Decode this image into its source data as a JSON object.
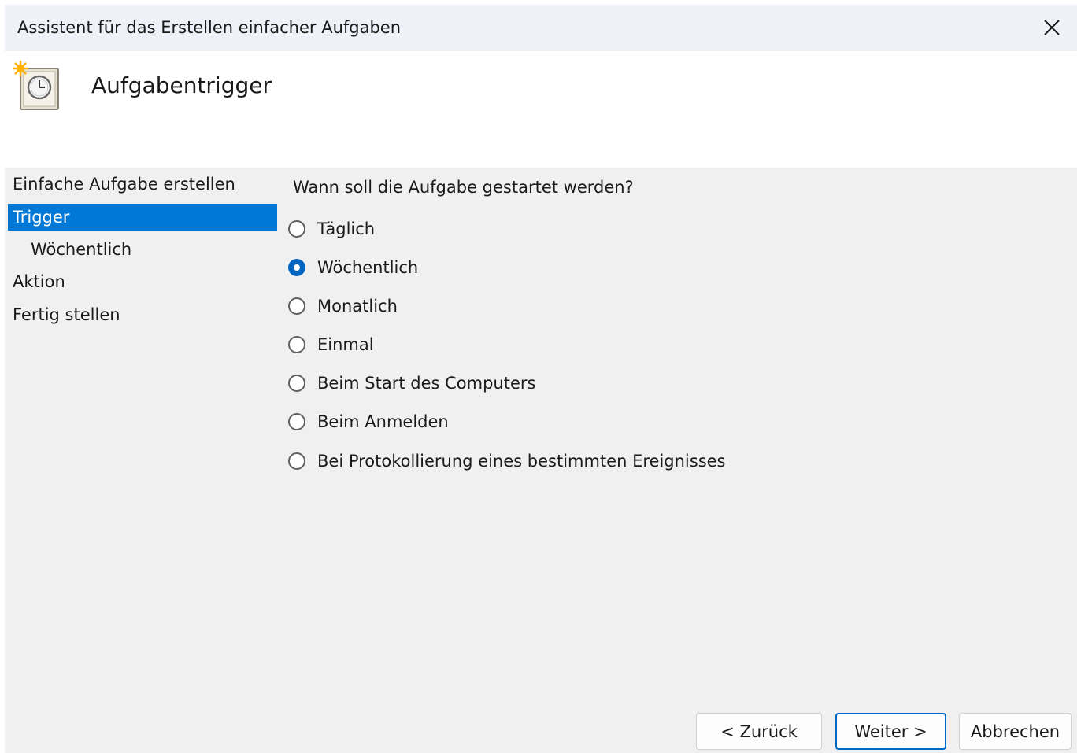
{
  "window": {
    "title": "Assistent für das Erstellen einfacher Aufgaben"
  },
  "header": {
    "title": "Aufgabentrigger",
    "icon": "task-scheduler-clock-icon"
  },
  "sidebar": {
    "items": [
      {
        "label": "Einfache Aufgabe erstellen",
        "active": false,
        "sub": false
      },
      {
        "label": "Trigger",
        "active": true,
        "sub": false
      },
      {
        "label": "Wöchentlich",
        "active": false,
        "sub": true
      },
      {
        "label": "Aktion",
        "active": false,
        "sub": false
      },
      {
        "label": "Fertig stellen",
        "active": false,
        "sub": false
      }
    ]
  },
  "main": {
    "question": "Wann soll die Aufgabe gestartet werden?",
    "options": [
      {
        "label": "Täglich",
        "checked": false
      },
      {
        "label": "Wöchentlich",
        "checked": true
      },
      {
        "label": "Monatlich",
        "checked": false
      },
      {
        "label": "Einmal",
        "checked": false
      },
      {
        "label": "Beim Start des Computers",
        "checked": false
      },
      {
        "label": "Beim Anmelden",
        "checked": false
      },
      {
        "label": "Bei Protokollierung eines bestimmten Ereignisses",
        "checked": false
      }
    ]
  },
  "buttons": {
    "back": "< Zurück",
    "next": "Weiter >",
    "cancel": "Abbrechen"
  },
  "colors": {
    "accent": "#0067c0",
    "selection": "#0078d7",
    "panel": "#f0f0f0",
    "titlebar": "#eef2f8"
  }
}
